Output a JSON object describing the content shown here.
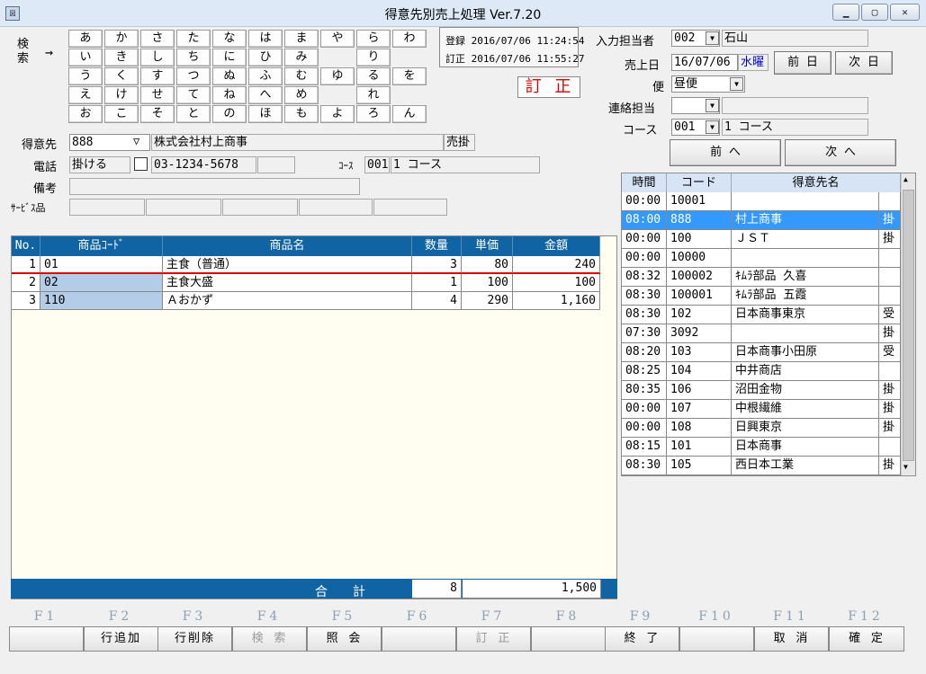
{
  "window": {
    "title": "得意先別売上処理 Ver.7.20",
    "icon": "app-icon",
    "icon_text": "図"
  },
  "search": {
    "label": "検 索",
    "arrow": "→",
    "kana_rows": [
      [
        "あ",
        "か",
        "さ",
        "た",
        "な",
        "は",
        "ま",
        "や",
        "ら",
        "わ"
      ],
      [
        "い",
        "き",
        "し",
        "ち",
        "に",
        "ひ",
        "み",
        "",
        "り",
        ""
      ],
      [
        "う",
        "く",
        "す",
        "つ",
        "ぬ",
        "ふ",
        "む",
        "ゆ",
        "る",
        "を"
      ],
      [
        "え",
        "け",
        "せ",
        "て",
        "ね",
        "へ",
        "め",
        "",
        "れ",
        ""
      ],
      [
        "お",
        "こ",
        "そ",
        "と",
        "の",
        "ほ",
        "も",
        "よ",
        "ろ",
        "ん"
      ]
    ]
  },
  "stamps": {
    "registered_label": "登録",
    "registered": "2016/07/06 11:24:54",
    "corrected_label": "訂正",
    "corrected": "2016/07/06 11:55:27",
    "mode": "訂 正"
  },
  "customer": {
    "label": "得意先",
    "code": "888",
    "name": "株式会社村上商事",
    "terms": "売掛",
    "phone_label": "電話",
    "phone_mode": "掛ける",
    "phone": "03-1234-5678",
    "course_label": "ｺｰｽ",
    "course_code": "001",
    "course_name": "1 コース",
    "note_label": "備考",
    "note": "",
    "service_label": "ｻｰﾋﾞｽ品"
  },
  "header_right": {
    "operator_label": "入力担当者",
    "operator_code": "002",
    "operator_name": "石山",
    "date_label": "売上日",
    "date": "16/07/06",
    "weekday": "水曜",
    "prev_day": "前 日",
    "next_day": "次 日",
    "delivery_label": "便",
    "delivery": "昼便",
    "contact_label": "連絡担当",
    "contact": "",
    "course_label": "コース",
    "course_code": "001",
    "course_name": "1 コース",
    "prev": "前 へ",
    "next": "次 へ"
  },
  "detail": {
    "columns": [
      "No.",
      "商品ｺｰﾄﾞ",
      "商品名",
      "数量",
      "単価",
      "金額"
    ],
    "rows": [
      {
        "no": "1",
        "code": "01",
        "name": "主食（普通）",
        "qty": "3",
        "price": "80",
        "amount": "240"
      },
      {
        "no": "2",
        "code": "02",
        "name": "主食大盛",
        "qty": "1",
        "price": "100",
        "amount": "100"
      },
      {
        "no": "3",
        "code": "110",
        "name": "Ａおかず",
        "qty": "4",
        "price": "290",
        "amount": "1,160"
      }
    ],
    "total_label": "合　　計",
    "total_qty": "8",
    "total_amount": "1,500"
  },
  "route_list": {
    "columns": [
      "時間",
      "コード",
      "得意先名"
    ],
    "selected_index": 1,
    "rows": [
      {
        "time": "00:00",
        "code": "10001",
        "name": "",
        "flag": ""
      },
      {
        "time": "08:00",
        "code": "888",
        "name": "村上商事",
        "flag": "掛"
      },
      {
        "time": "00:00",
        "code": "100",
        "name": "ＪＳＴ",
        "flag": "掛"
      },
      {
        "time": "00:00",
        "code": "10000",
        "name": "",
        "flag": ""
      },
      {
        "time": "08:32",
        "code": "100002",
        "name": "ｷﾑﾗ部品 久喜",
        "flag": ""
      },
      {
        "time": "08:30",
        "code": "100001",
        "name": "ｷﾑﾗ部品 五霞",
        "flag": ""
      },
      {
        "time": "08:30",
        "code": "102",
        "name": "日本商事東京",
        "flag": "受"
      },
      {
        "time": "07:30",
        "code": "3092",
        "name": "",
        "flag": "掛"
      },
      {
        "time": "08:20",
        "code": "103",
        "name": "日本商事小田原",
        "flag": "受"
      },
      {
        "time": "08:25",
        "code": "104",
        "name": "中井商店",
        "flag": ""
      },
      {
        "time": "80:35",
        "code": "106",
        "name": "沼田金物",
        "flag": "掛"
      },
      {
        "time": "00:00",
        "code": "107",
        "name": "中根繊維",
        "flag": "掛"
      },
      {
        "time": "00:00",
        "code": "108",
        "name": "日興東京",
        "flag": "掛"
      },
      {
        "time": "08:15",
        "code": "101",
        "name": "日本商事",
        "flag": ""
      },
      {
        "time": "08:30",
        "code": "105",
        "name": "西日本工業",
        "flag": "掛"
      }
    ]
  },
  "fkeys": [
    {
      "key": "F1",
      "label": "",
      "enabled": false
    },
    {
      "key": "F2",
      "label": "行追加",
      "enabled": true
    },
    {
      "key": "F3",
      "label": "行削除",
      "enabled": true
    },
    {
      "key": "F4",
      "label": "検 索",
      "enabled": false
    },
    {
      "key": "F5",
      "label": "照 会",
      "enabled": true
    },
    {
      "key": "F6",
      "label": "",
      "enabled": false
    },
    {
      "key": "F7",
      "label": "訂 正",
      "enabled": false
    },
    {
      "key": "F8",
      "label": "",
      "enabled": false
    },
    {
      "key": "F9",
      "label": "終 了",
      "enabled": true
    },
    {
      "key": "F10",
      "label": "",
      "enabled": false
    },
    {
      "key": "F11",
      "label": "取 消",
      "enabled": true
    },
    {
      "key": "F12",
      "label": "確 定",
      "enabled": true
    }
  ],
  "colors": {
    "header_blue": "#1164a3",
    "selection": "#3399ff",
    "mode_red": "#e00000",
    "weekday_blue": "#0000cc"
  }
}
